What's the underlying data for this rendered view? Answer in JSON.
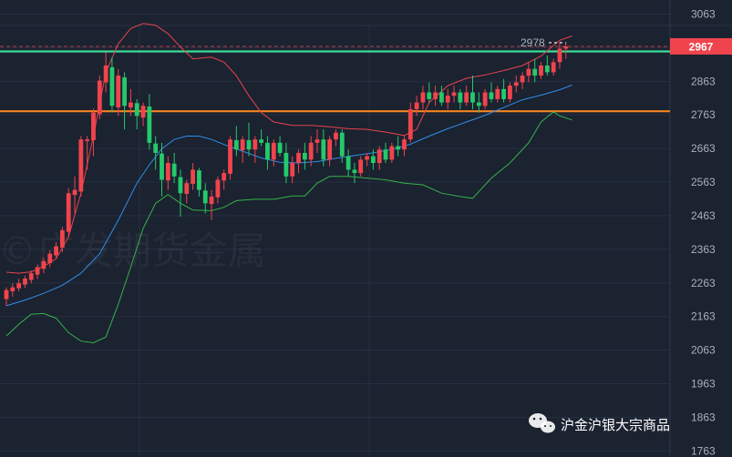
{
  "chart_data": {
    "type": "candlestick",
    "y_ticks": [
      3063,
      2963,
      2863,
      2763,
      2663,
      2563,
      2463,
      2363,
      2263,
      2163,
      2063,
      1963,
      1863,
      1763
    ],
    "ylim": [
      1745,
      3105
    ],
    "current_price": 2967,
    "peak_label": 2978,
    "support_levels": [
      {
        "value": 2952,
        "color": "#3ddc97"
      },
      {
        "value": 2774,
        "color": "#f5841f"
      }
    ],
    "candles": [
      [
        2215,
        2250,
        2195,
        2242
      ],
      [
        2238,
        2262,
        2222,
        2250
      ],
      [
        2247,
        2275,
        2238,
        2262
      ],
      [
        2258,
        2285,
        2248,
        2276
      ],
      [
        2272,
        2300,
        2262,
        2292
      ],
      [
        2288,
        2318,
        2275,
        2310
      ],
      [
        2305,
        2338,
        2292,
        2328
      ],
      [
        2322,
        2360,
        2310,
        2350
      ],
      [
        2345,
        2385,
        2335,
        2372
      ],
      [
        2368,
        2430,
        2355,
        2420
      ],
      [
        2415,
        2545,
        2400,
        2530
      ],
      [
        2525,
        2580,
        2470,
        2540
      ],
      [
        2535,
        2700,
        2520,
        2690
      ],
      [
        2685,
        2700,
        2600,
        2690
      ],
      [
        2688,
        2782,
        2640,
        2770
      ],
      [
        2765,
        2880,
        2750,
        2865
      ],
      [
        2860,
        2950,
        2830,
        2910
      ],
      [
        2905,
        2935,
        2770,
        2790
      ],
      [
        2785,
        2900,
        2760,
        2880
      ],
      [
        2875,
        2890,
        2720,
        2790
      ],
      [
        2785,
        2840,
        2760,
        2800
      ],
      [
        2798,
        2810,
        2720,
        2760
      ],
      [
        2755,
        2800,
        2730,
        2790
      ],
      [
        2788,
        2825,
        2660,
        2680
      ],
      [
        2678,
        2700,
        2600,
        2650
      ],
      [
        2648,
        2680,
        2520,
        2570
      ],
      [
        2568,
        2640,
        2540,
        2620
      ],
      [
        2618,
        2650,
        2560,
        2580
      ],
      [
        2578,
        2600,
        2460,
        2530
      ],
      [
        2528,
        2570,
        2500,
        2560
      ],
      [
        2558,
        2620,
        2540,
        2600
      ],
      [
        2598,
        2605,
        2520,
        2540
      ],
      [
        2538,
        2560,
        2470,
        2500
      ],
      [
        2498,
        2540,
        2450,
        2520
      ],
      [
        2518,
        2580,
        2500,
        2570
      ],
      [
        2568,
        2600,
        2540,
        2590
      ],
      [
        2588,
        2700,
        2570,
        2690
      ],
      [
        2688,
        2730,
        2640,
        2660
      ],
      [
        2658,
        2700,
        2620,
        2690
      ],
      [
        2688,
        2740,
        2640,
        2660
      ],
      [
        2660,
        2700,
        2620,
        2690
      ],
      [
        2690,
        2720,
        2670,
        2680
      ],
      [
        2680,
        2700,
        2600,
        2630
      ],
      [
        2630,
        2690,
        2610,
        2680
      ],
      [
        2680,
        2700,
        2640,
        2650
      ],
      [
        2650,
        2680,
        2560,
        2580
      ],
      [
        2580,
        2640,
        2560,
        2620
      ],
      [
        2620,
        2660,
        2590,
        2650
      ],
      [
        2650,
        2680,
        2600,
        2630
      ],
      [
        2630,
        2700,
        2610,
        2680
      ],
      [
        2680,
        2720,
        2650,
        2690
      ],
      [
        2690,
        2720,
        2610,
        2630
      ],
      [
        2630,
        2700,
        2610,
        2690
      ],
      [
        2690,
        2720,
        2670,
        2710
      ],
      [
        2710,
        2720,
        2620,
        2640
      ],
      [
        2640,
        2660,
        2580,
        2600
      ],
      [
        2600,
        2620,
        2560,
        2590
      ],
      [
        2590,
        2640,
        2580,
        2630
      ],
      [
        2630,
        2650,
        2610,
        2640
      ],
      [
        2640,
        2660,
        2600,
        2620
      ],
      [
        2620,
        2670,
        2600,
        2660
      ],
      [
        2660,
        2680,
        2620,
        2630
      ],
      [
        2630,
        2680,
        2620,
        2670
      ],
      [
        2670,
        2700,
        2640,
        2660
      ],
      [
        2660,
        2700,
        2640,
        2690
      ],
      [
        2690,
        2800,
        2680,
        2780
      ],
      [
        2780,
        2820,
        2760,
        2800
      ],
      [
        2800,
        2850,
        2780,
        2830
      ],
      [
        2830,
        2860,
        2800,
        2810
      ],
      [
        2810,
        2850,
        2790,
        2830
      ],
      [
        2830,
        2850,
        2790,
        2800
      ],
      [
        2800,
        2840,
        2780,
        2820
      ],
      [
        2820,
        2850,
        2800,
        2830
      ],
      [
        2830,
        2840,
        2780,
        2800
      ],
      [
        2800,
        2850,
        2790,
        2830
      ],
      [
        2830,
        2880,
        2780,
        2800
      ],
      [
        2800,
        2830,
        2770,
        2790
      ],
      [
        2790,
        2840,
        2780,
        2830
      ],
      [
        2830,
        2860,
        2800,
        2810
      ],
      [
        2810,
        2850,
        2800,
        2840
      ],
      [
        2840,
        2870,
        2800,
        2810
      ],
      [
        2810,
        2860,
        2800,
        2850
      ],
      [
        2850,
        2880,
        2830,
        2860
      ],
      [
        2860,
        2890,
        2840,
        2880
      ],
      [
        2880,
        2920,
        2860,
        2900
      ],
      [
        2900,
        2930,
        2860,
        2880
      ],
      [
        2880,
        2920,
        2870,
        2910
      ],
      [
        2910,
        2940,
        2880,
        2890
      ],
      [
        2890,
        2930,
        2880,
        2920
      ],
      [
        2920,
        2980,
        2900,
        2960
      ],
      [
        2960,
        2978,
        2930,
        2967
      ]
    ],
    "boll_mid": [
      [
        0,
        2195
      ],
      [
        3,
        2212
      ],
      [
        6,
        2232
      ],
      [
        9,
        2256
      ],
      [
        12,
        2292
      ],
      [
        15,
        2350
      ],
      [
        18,
        2450
      ],
      [
        21,
        2560
      ],
      [
        23,
        2615
      ],
      [
        25,
        2662
      ],
      [
        27,
        2690
      ],
      [
        29,
        2700
      ],
      [
        31,
        2700
      ],
      [
        33,
        2690
      ],
      [
        35,
        2675
      ],
      [
        38,
        2655
      ],
      [
        41,
        2635
      ],
      [
        44,
        2622
      ],
      [
        47,
        2620
      ],
      [
        50,
        2624
      ],
      [
        53,
        2634
      ],
      [
        56,
        2642
      ],
      [
        59,
        2650
      ],
      [
        62,
        2660
      ],
      [
        65,
        2676
      ],
      [
        68,
        2700
      ],
      [
        71,
        2722
      ],
      [
        74,
        2742
      ],
      [
        77,
        2762
      ],
      [
        80,
        2785
      ],
      [
        83,
        2808
      ],
      [
        86,
        2822
      ],
      [
        89,
        2838
      ],
      [
        91,
        2852
      ]
    ],
    "boll_upper": [
      [
        0,
        2295
      ],
      [
        2,
        2292
      ],
      [
        4,
        2296
      ],
      [
        6,
        2312
      ],
      [
        8,
        2335
      ],
      [
        10,
        2400
      ],
      [
        12,
        2530
      ],
      [
        14,
        2700
      ],
      [
        16,
        2890
      ],
      [
        18,
        2975
      ],
      [
        20,
        3020
      ],
      [
        22,
        3035
      ],
      [
        24,
        3030
      ],
      [
        26,
        3005
      ],
      [
        28,
        2965
      ],
      [
        30,
        2930
      ],
      [
        33,
        2935
      ],
      [
        35,
        2920
      ],
      [
        37,
        2880
      ],
      [
        39,
        2820
      ],
      [
        41,
        2770
      ],
      [
        43,
        2742
      ],
      [
        46,
        2732
      ],
      [
        49,
        2732
      ],
      [
        52,
        2728
      ],
      [
        55,
        2722
      ],
      [
        58,
        2720
      ],
      [
        61,
        2712
      ],
      [
        64,
        2702
      ],
      [
        66,
        2720
      ],
      [
        68,
        2800
      ],
      [
        71,
        2850
      ],
      [
        74,
        2872
      ],
      [
        77,
        2882
      ],
      [
        80,
        2895
      ],
      [
        83,
        2910
      ],
      [
        86,
        2938
      ],
      [
        89,
        2985
      ],
      [
        91,
        2998
      ]
    ],
    "boll_lower": [
      [
        0,
        2105
      ],
      [
        2,
        2140
      ],
      [
        4,
        2170
      ],
      [
        6,
        2172
      ],
      [
        8,
        2158
      ],
      [
        10,
        2115
      ],
      [
        12,
        2090
      ],
      [
        14,
        2085
      ],
      [
        16,
        2102
      ],
      [
        18,
        2200
      ],
      [
        20,
        2310
      ],
      [
        22,
        2425
      ],
      [
        24,
        2500
      ],
      [
        26,
        2526
      ],
      [
        28,
        2500
      ],
      [
        30,
        2480
      ],
      [
        33,
        2478
      ],
      [
        35,
        2488
      ],
      [
        37,
        2508
      ],
      [
        40,
        2512
      ],
      [
        43,
        2512
      ],
      [
        46,
        2522
      ],
      [
        48,
        2522
      ],
      [
        50,
        2560
      ],
      [
        52,
        2580
      ],
      [
        55,
        2580
      ],
      [
        58,
        2575
      ],
      [
        61,
        2570
      ],
      [
        64,
        2560
      ],
      [
        67,
        2555
      ],
      [
        70,
        2530
      ],
      [
        73,
        2520
      ],
      [
        75,
        2515
      ],
      [
        78,
        2575
      ],
      [
        81,
        2620
      ],
      [
        84,
        2680
      ],
      [
        86,
        2742
      ],
      [
        88,
        2772
      ],
      [
        89,
        2760
      ],
      [
        91,
        2748
      ]
    ],
    "colors": {
      "up": "#f0444d",
      "down": "#25c96b",
      "mid": "#2f8fe8",
      "upper": "#e8424d",
      "lower": "#33b34a",
      "price_badge": "#f0444d",
      "grid": "#263042",
      "background": "#1b2230"
    }
  },
  "watermark": {
    "background_text": "©广发期货金属",
    "channel_name": "沪金沪银大宗商品",
    "icon": "wechat-icon"
  }
}
